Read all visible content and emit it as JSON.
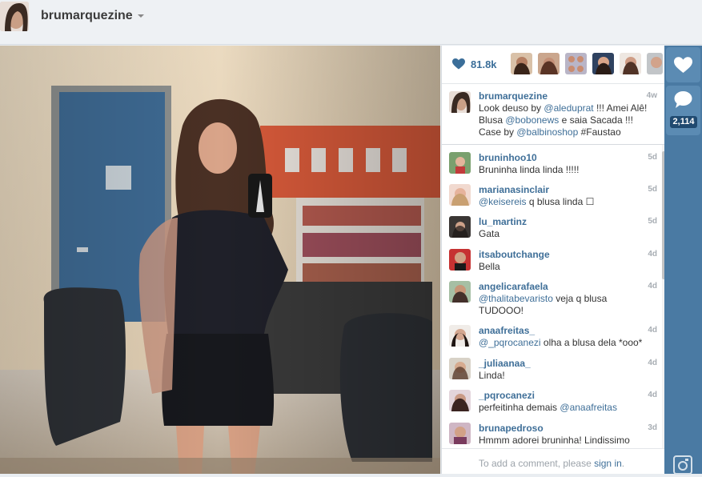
{
  "header": {
    "username": "brumarquezine"
  },
  "photo": {
    "description_icon": "selfie-photo"
  },
  "likes": {
    "count": "81.8k"
  },
  "caption": {
    "username": "brumarquezine",
    "time": "4w",
    "line1_a": "Look deuso by ",
    "line1_mention": "@aleduprat",
    "line1_b": " !!! Amei Alê!",
    "line2_a": "Blusa ",
    "line2_mention": "@bobonews",
    "line2_b": " e saia Sacada !!!",
    "line3_a": "Case by ",
    "line3_mention": "@balbinoshop",
    "line3_b": " #Faustao"
  },
  "comments": [
    {
      "user": "bruninhoo10",
      "time": "5d",
      "text": "Bruninha linda linda !!!!!"
    },
    {
      "user": "marianasinclair",
      "time": "5d",
      "mention": "@keisereis",
      "text": " q blusa linda ☐"
    },
    {
      "user": "lu_martinz",
      "time": "5d",
      "text": "Gata"
    },
    {
      "user": "itsaboutchange",
      "time": "4d",
      "text": "Bella"
    },
    {
      "user": "angelicarafaela",
      "time": "4d",
      "mention": "@thalitabevaristo",
      "text": " veja q blusa",
      "text2": "TUDOOO!"
    },
    {
      "user": "anaafreitas_",
      "time": "4d",
      "mention": "@_pqrocanezi",
      "text": " olha a blusa dela *ooo*"
    },
    {
      "user": "_juliaanaa_",
      "time": "4d",
      "text": "Linda!"
    },
    {
      "user": "_pqrocanezi",
      "time": "4d",
      "text": "perfeitinha demais ",
      "mention_end": "@anaafreitas"
    },
    {
      "user": "brunapedroso",
      "time": "3d",
      "text": "Hmmm adorei bruninha! Lindissimo"
    }
  ],
  "add_comment": {
    "prefix": "To add a comment, please ",
    "link": "sign in",
    "suffix": "."
  },
  "rail": {
    "comment_count": "2,114"
  },
  "colors": {
    "accent": "#3f6f98",
    "rail": "#4a7aa3"
  }
}
